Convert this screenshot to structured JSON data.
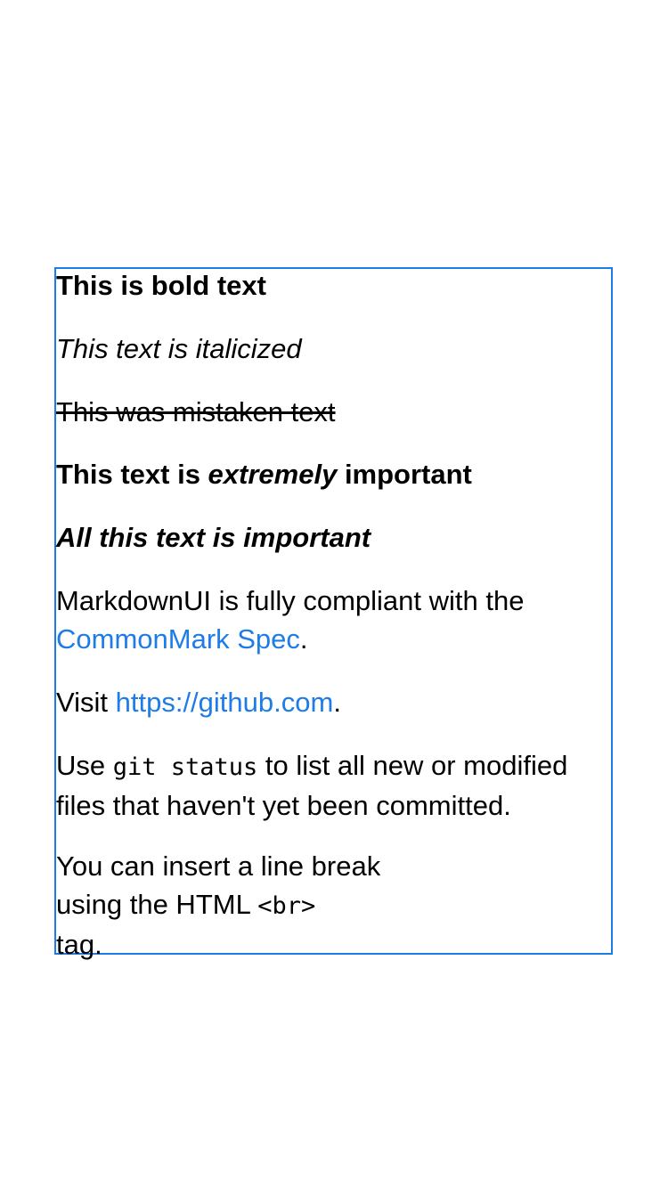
{
  "colors": {
    "border": "#1E7CE6",
    "link": "#1E7CE6",
    "text": "#000000",
    "background": "#FFFFFF"
  },
  "markdown": {
    "bold_text": "This is bold text",
    "italic_text": "This text is italicized",
    "strike_text": "This was mistaken text",
    "important_prefix": "This text is ",
    "important_emphasis": "extremely",
    "important_suffix": " important",
    "all_important": "All this text is important",
    "compliance_prefix": "MarkdownUI is fully compliant with the",
    "compliance_link": "CommonMark Spec",
    "compliance_suffix": ".",
    "visit_prefix": "Visit ",
    "visit_link": "https://github.com",
    "visit_suffix": ".",
    "git_prefix": "Use ",
    "git_code": "git status",
    "git_suffix_line1": " to list all new or modified",
    "git_line2": "files that haven't yet been committed.",
    "br_line1": "You can insert a line break",
    "br_line2_prefix": "using the HTML ",
    "br_code": "<br>",
    "br_line3": "tag."
  }
}
